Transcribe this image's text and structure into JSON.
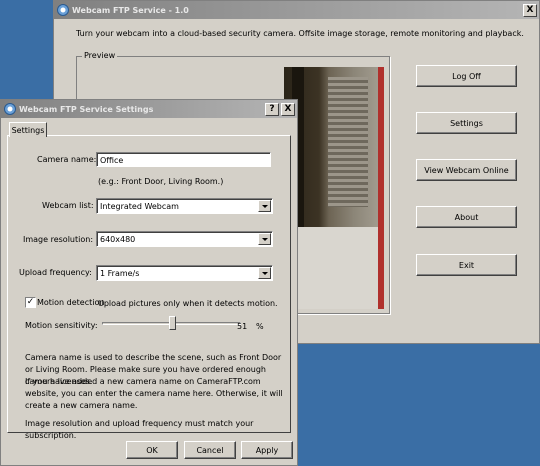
{
  "main_window": {
    "title": "Webcam FTP Service - 1.0",
    "close_glyph": "X",
    "description": "Turn your webcam into a cloud-based security camera. Offsite image storage, remote monitoring and playback.",
    "preview_label": "Preview",
    "buttons": {
      "log_off": "Log Off",
      "settings": "Settings",
      "view_online": "View Webcam Online",
      "about": "About",
      "exit": "Exit"
    }
  },
  "settings_dialog": {
    "title": "Webcam FTP Service Settings",
    "help_glyph": "?",
    "close_glyph": "X",
    "tab_label": "Settings",
    "camera_name": {
      "label": "Camera name:",
      "value": "Office",
      "hint": "(e.g.: Front Door, Living Room.)"
    },
    "webcam_list": {
      "label": "Webcam list:",
      "value": "Integrated Webcam"
    },
    "image_resolution": {
      "label": "Image resolution:",
      "value": "640x480"
    },
    "upload_frequency": {
      "label": "Upload frequency:",
      "value": "1 Frame/s"
    },
    "motion_detection": {
      "label": "Motion detection",
      "checked": true,
      "check_glyph": "✓",
      "description": "Upload pictures only when it detects motion."
    },
    "motion_sensitivity": {
      "label": "Motion sensitivity:",
      "value": "51",
      "unit": "%",
      "fraction": 0.51
    },
    "info_text_1": "Camera name is used to describe the scene, such as Front Door or Living Room. Please make sure you have ordered enough camera licenses.",
    "info_text_2": "If you have added a new camera name on CameraFTP.com website, you can enter the camera name here.  Otherwise, it will create a new camera name.",
    "info_text_3": "Image resolution and upload frequency must match your subscription.",
    "buttons": {
      "ok": "OK",
      "cancel": "Cancel",
      "apply": "Apply"
    }
  },
  "colors": {
    "desktop": "#3a6ea5",
    "window_face": "#d4d0c8",
    "inactive_title": "#808080"
  }
}
